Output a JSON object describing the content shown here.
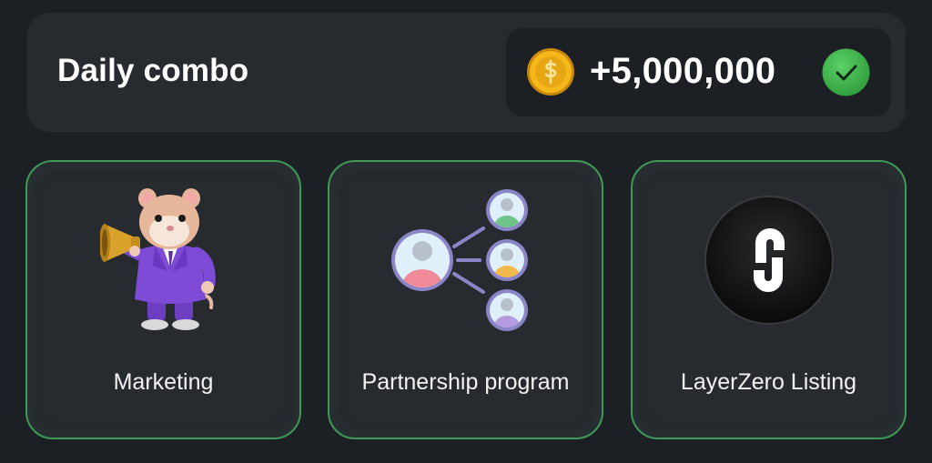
{
  "daily_combo": {
    "title": "Daily combo",
    "reward": "+5,000,000",
    "coin_icon": "coin-icon",
    "status_icon": "check-icon",
    "status_color": "#3fb04f"
  },
  "cards": [
    {
      "label": "Marketing",
      "icon": "hamster-megaphone-icon"
    },
    {
      "label": "Partnership program",
      "icon": "referral-network-icon"
    },
    {
      "label": "LayerZero Listing",
      "icon": "layerzero-logo-icon"
    }
  ],
  "colors": {
    "background": "#1c1f24",
    "panel": "#272a2f",
    "card_border": "#3f9a58",
    "coin": "#f5b71a"
  }
}
